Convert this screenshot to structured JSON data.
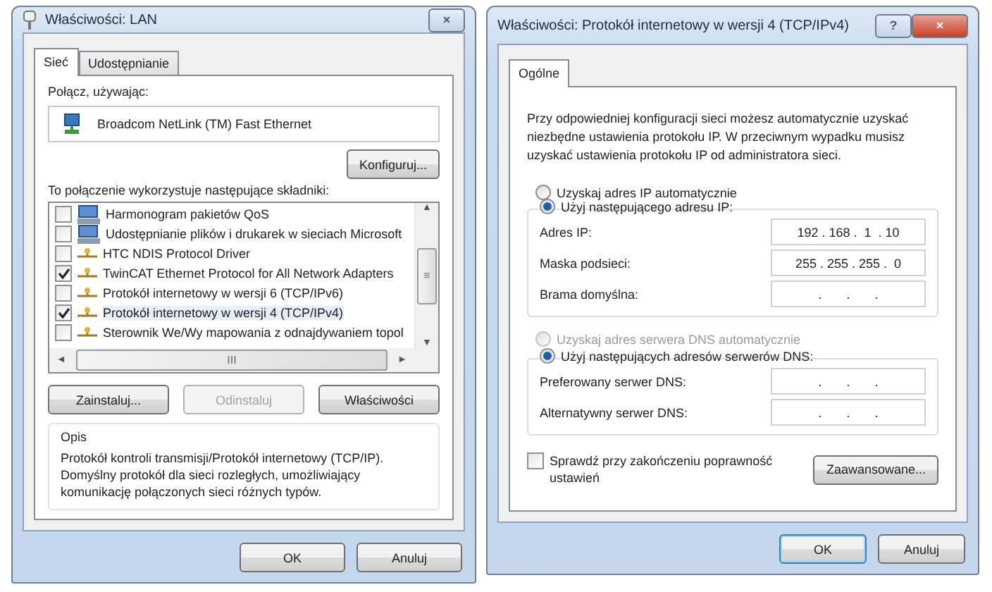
{
  "lan_dialog": {
    "title": "Właściwości: LAN",
    "close": "×",
    "tabs": [
      {
        "label": "Sieć",
        "selected": true
      },
      {
        "label": "Udostępnianie",
        "selected": false
      }
    ],
    "connect_using_label": "Połącz, używając:",
    "adapter": "Broadcom NetLink (TM) Fast Ethernet",
    "configure_button": "Konfiguruj...",
    "components_label": "To połączenie wykorzystuje następujące składniki:",
    "components": [
      {
        "kind": "service",
        "label": "Harmonogram pakietów QoS",
        "checked": false,
        "selected": false
      },
      {
        "kind": "service",
        "label": "Udostępnianie plików i drukarek w sieciach Microsoft",
        "checked": false,
        "selected": false
      },
      {
        "kind": "protocol",
        "label": "HTC NDIS Protocol Driver",
        "checked": false,
        "selected": false
      },
      {
        "kind": "protocol",
        "label": "TwinCAT Ethernet Protocol for All Network Adapters",
        "checked": true,
        "selected": false
      },
      {
        "kind": "protocol",
        "label": "Protokół internetowy w wersji 6 (TCP/IPv6)",
        "checked": false,
        "selected": false
      },
      {
        "kind": "protocol",
        "label": "Protokół internetowy w wersji 4 (TCP/IPv4)",
        "checked": true,
        "selected": true
      },
      {
        "kind": "protocol",
        "label": "Sterownik We/Wy mapowania z odnajdywaniem topol",
        "checked": false,
        "selected": false
      }
    ],
    "scroll_glyphs": {
      "up": "▲",
      "down": "▼",
      "left": "◄",
      "right": "►",
      "grip": "≡",
      "hgrip": "III"
    },
    "actions": [
      {
        "label": "Zainstaluj...",
        "disabled": false
      },
      {
        "label": "Odinstaluj",
        "disabled": true
      },
      {
        "label": "Właściwości",
        "disabled": false
      }
    ],
    "description_title": "Opis",
    "description": "Protokół kontroli transmisji/Protokół internetowy (TCP/IP). Domyślny protokół dla sieci rozległych, umożliwiający komunikację połączonych sieci różnych typów.",
    "buttons": [
      {
        "label": "OK"
      },
      {
        "label": "Anuluj"
      }
    ]
  },
  "ipv4_dialog": {
    "title": "Właściwości: Protokół internetowy w wersji 4 (TCP/IPv4)",
    "help": "?",
    "close": "×",
    "tabs": [
      {
        "label": "Ogólne",
        "selected": true
      }
    ],
    "intro": "Przy odpowiedniej konfiguracji sieci możesz automatycznie uzyskać niezbędne ustawienia protokołu IP. W przeciwnym wypadku musisz uzyskać ustawienia protokołu IP od administratora sieci.",
    "ip_auto": {
      "label": "Uzyskaj adres IP automatycznie",
      "selected": false,
      "disabled": false
    },
    "ip_manual": {
      "label": "Użyj następującego adresu IP:",
      "selected": true,
      "disabled": false
    },
    "ip_fields": [
      {
        "label": "Adres IP:",
        "value": "192 . 168 .  1  . 10"
      },
      {
        "label": "Maska podsieci:",
        "value": "255 . 255 . 255 .  0"
      },
      {
        "label": "Brama domyślna:",
        "value": ".       .       ."
      }
    ],
    "dns_auto": {
      "label": "Uzyskaj adres serwera DNS automatycznie",
      "selected": false,
      "disabled": true
    },
    "dns_manual": {
      "label": "Użyj następujących adresów serwerów DNS:",
      "selected": true,
      "disabled": false
    },
    "dns_fields": [
      {
        "label": "Preferowany serwer DNS:",
        "value": ".       .       ."
      },
      {
        "label": "Alternatywny serwer DNS:",
        "value": ".       .       ."
      }
    ],
    "validate": {
      "label": "Sprawdź przy zakończeniu poprawność ustawień",
      "checked": false
    },
    "advanced_button": "Zaawansowane...",
    "buttons": [
      {
        "label": "OK",
        "default": true
      },
      {
        "label": "Anuluj",
        "default": false
      }
    ]
  }
}
